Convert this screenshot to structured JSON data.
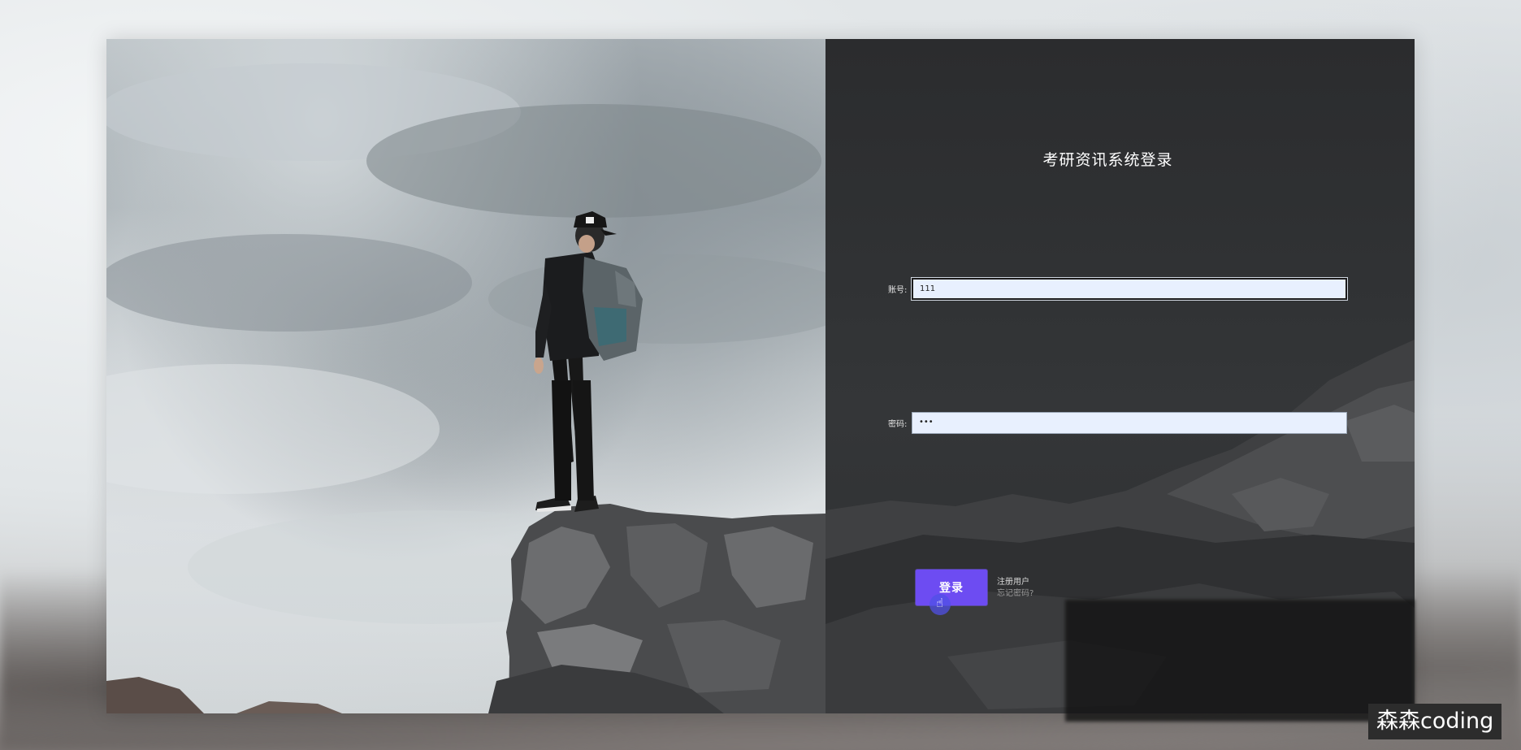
{
  "login": {
    "title": "考研资讯系统登录",
    "account_label": "账号:",
    "account_value": "111",
    "password_label": "密码:",
    "password_value": "•••",
    "login_button": "登录",
    "register_link": "注册用户",
    "forgot_link": "忘记密码?"
  },
  "watermark": {
    "text": "森森coding"
  },
  "colors": {
    "panel_bg": "#2e3032",
    "button_bg": "#6d4cf2",
    "input_bg": "#e8f0fe"
  }
}
